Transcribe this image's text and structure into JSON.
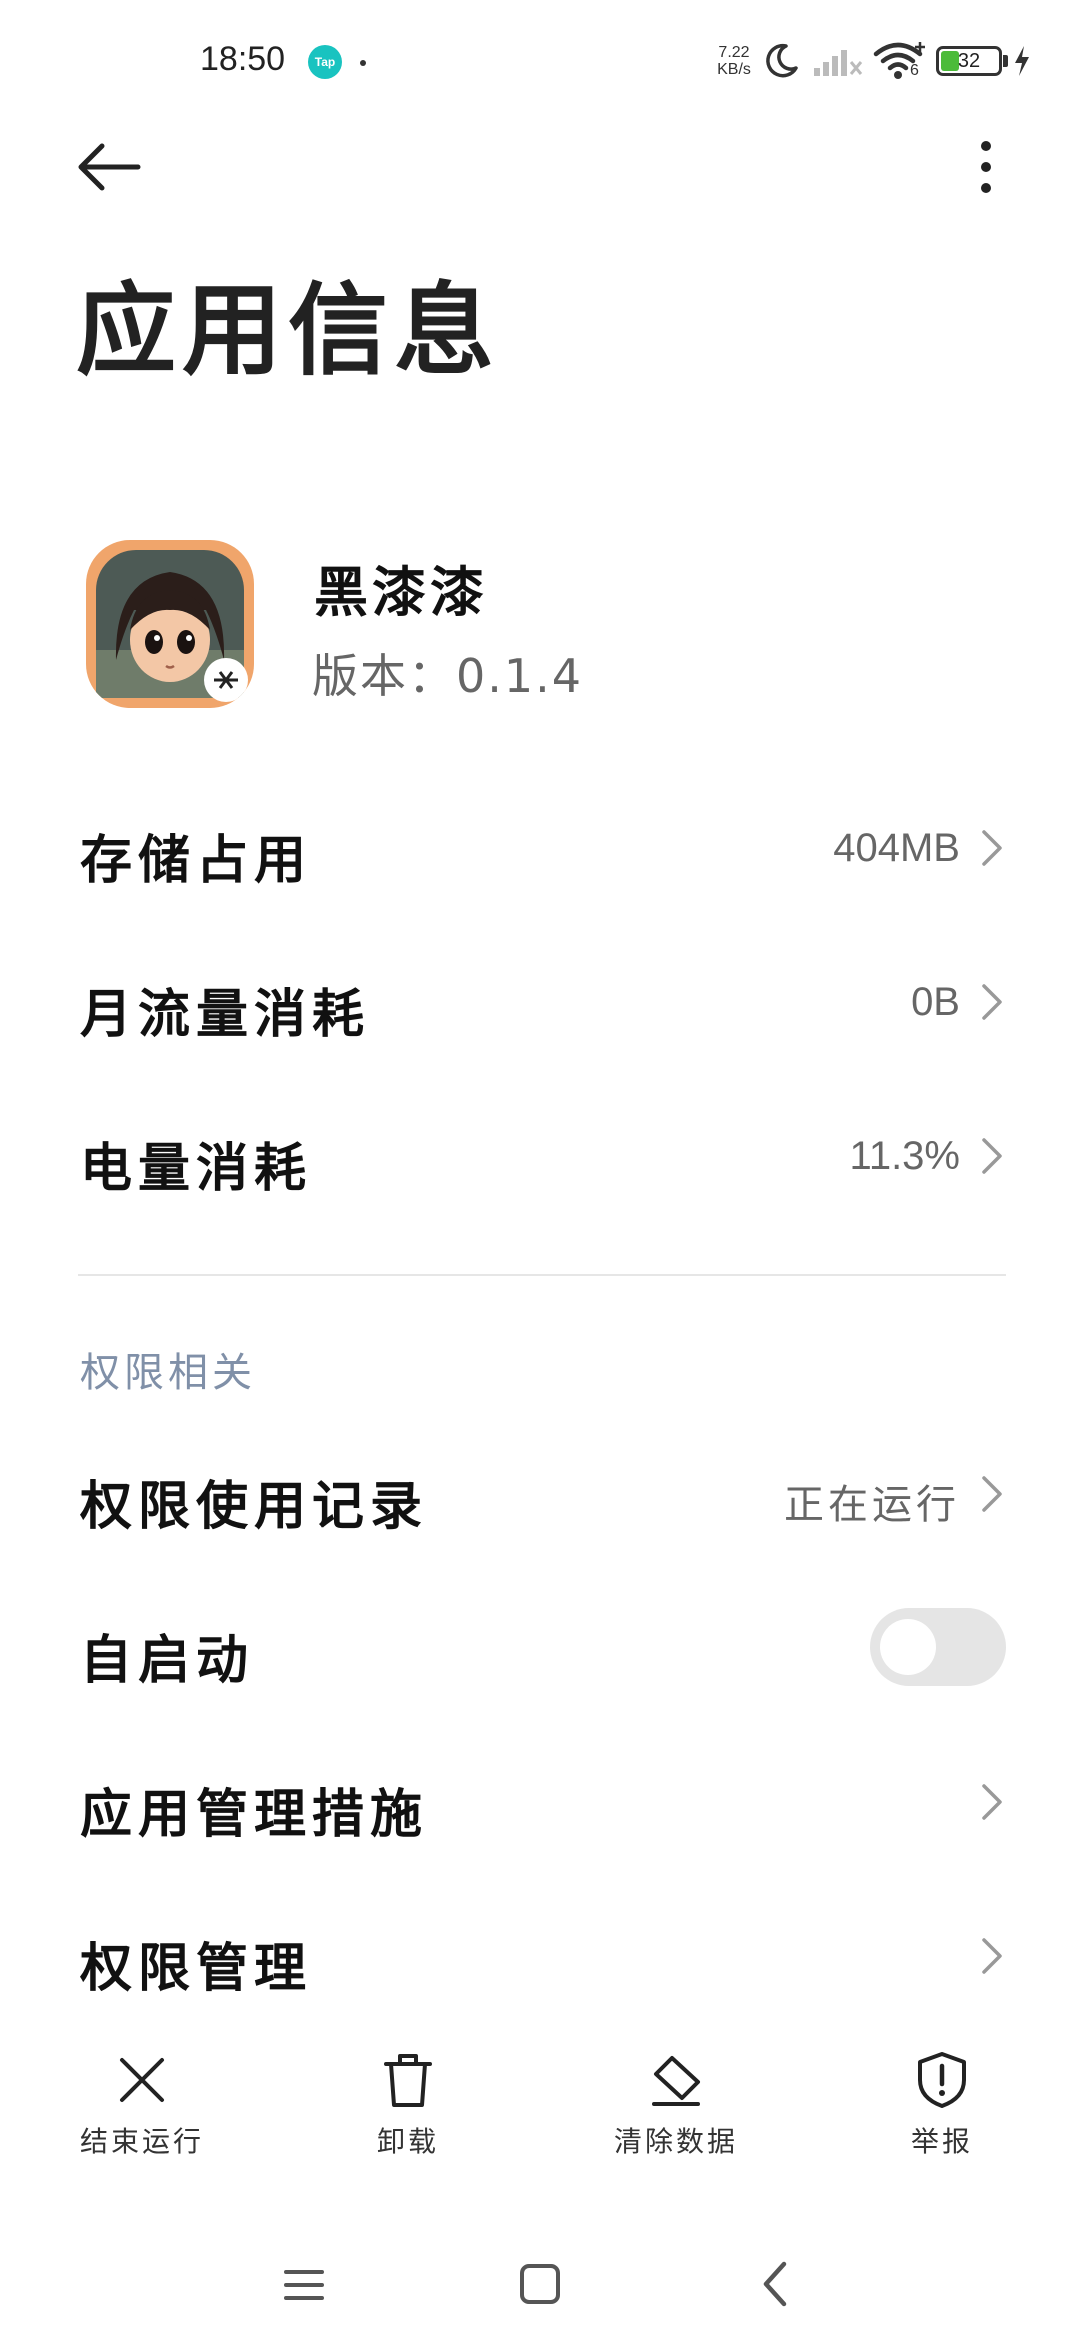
{
  "status_bar": {
    "time": "18:50",
    "tap_badge": "Tap",
    "net_speed_value": "7.22",
    "net_speed_unit": "KB/s",
    "battery": "32",
    "wifi_badge": "6",
    "icons": [
      "tap-app-icon",
      "notification-dot-icon",
      "moon-icon",
      "cellular-signal-icon",
      "wifi-icon",
      "battery-icon",
      "charging-icon"
    ]
  },
  "header": {
    "title": "应用信息",
    "back_icon": "arrow-left-icon",
    "more_icon": "more-vertical-icon"
  },
  "app": {
    "name": "黑漆漆",
    "version": "版本：0.1.4"
  },
  "stats": [
    {
      "label": "存储占用",
      "value": "404MB"
    },
    {
      "label": "月流量消耗",
      "value": "0B"
    },
    {
      "label": "电量消耗",
      "value": "11.3%"
    }
  ],
  "permissions": {
    "section_title": "权限相关",
    "items": [
      {
        "label": "权限使用记录",
        "value": "正在运行"
      },
      {
        "label": "自启动",
        "toggle_on": false
      },
      {
        "label": "应用管理措施"
      },
      {
        "label": "权限管理"
      }
    ]
  },
  "actions": [
    {
      "label": "结束运行",
      "icon": "close-icon"
    },
    {
      "label": "卸载",
      "icon": "trash-icon"
    },
    {
      "label": "清除数据",
      "icon": "eraser-icon"
    },
    {
      "label": "举报",
      "icon": "shield-alert-icon"
    }
  ],
  "nav": {
    "icons": [
      "menu-icon",
      "home-square-icon",
      "back-chevron-icon"
    ]
  },
  "colors": {
    "section_header": "#8090a8",
    "toggle_off": "#e5e5e5",
    "battery_fill": "#4cbb3a",
    "tap_badge": "#19c3c0"
  }
}
